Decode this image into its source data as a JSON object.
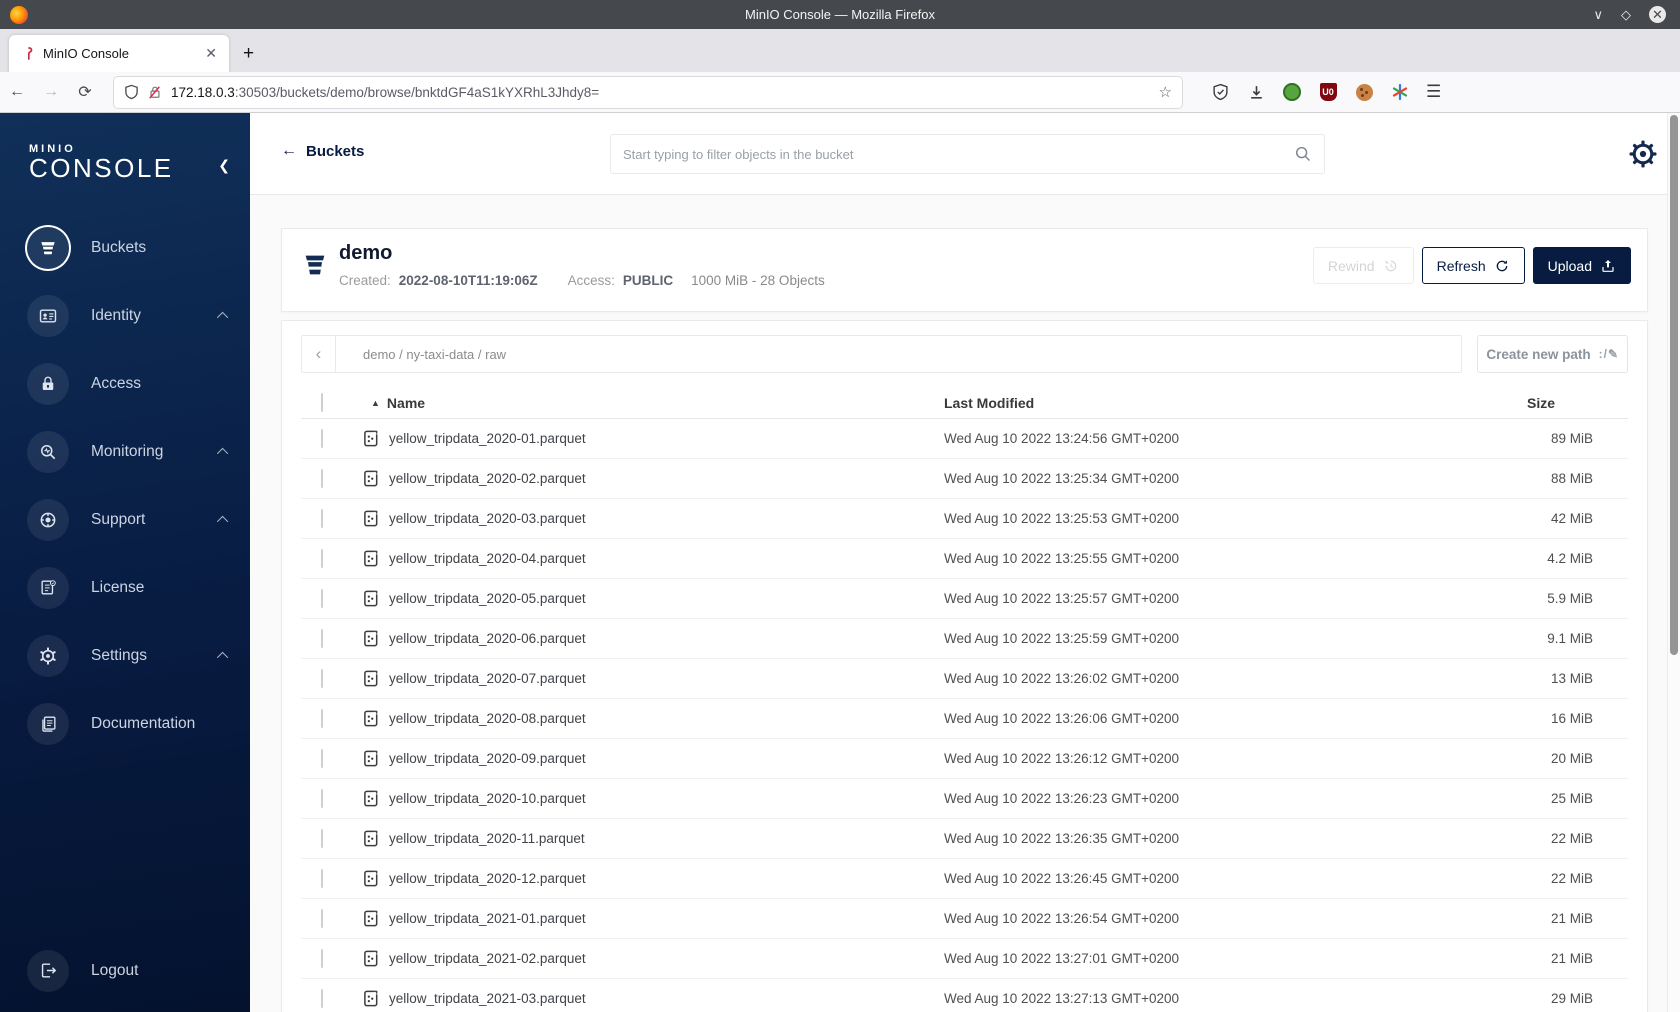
{
  "browser": {
    "window_title": "MinIO Console — Mozilla Firefox",
    "tab_title": "MinIO Console",
    "url_host": "172.18.0.3",
    "url_rest": ":30503/buckets/demo/browse/bnktdGF4aS1kYXRhL3Jhdy8="
  },
  "sidebar": {
    "logo_top": "MINIO",
    "logo_bottom": "CONSOLE",
    "items": [
      {
        "label": "Buckets",
        "selected": true
      },
      {
        "label": "Identity",
        "expandable": true
      },
      {
        "label": "Access"
      },
      {
        "label": "Monitoring",
        "expandable": true
      },
      {
        "label": "Support",
        "expandable": true
      },
      {
        "label": "License"
      },
      {
        "label": "Settings",
        "expandable": true
      },
      {
        "label": "Documentation"
      }
    ],
    "logout_label": "Logout"
  },
  "header": {
    "back_label": "Buckets",
    "search_placeholder": "Start typing to filter objects in the bucket"
  },
  "bucket": {
    "name": "demo",
    "created_label": "Created:",
    "created_value": "2022-08-10T11:19:06Z",
    "access_label": "Access:",
    "access_value": "PUBLIC",
    "usage": "1000 MiB - 28 Objects",
    "rewind_label": "Rewind",
    "refresh_label": "Refresh",
    "upload_label": "Upload"
  },
  "browse": {
    "path": "demo / ny-taxi-data / raw",
    "create_new_path_label": "Create new path"
  },
  "table": {
    "columns": {
      "name": "Name",
      "modified": "Last Modified",
      "size": "Size"
    },
    "rows": [
      {
        "name": "yellow_tripdata_2020-01.parquet",
        "modified": "Wed Aug 10 2022 13:24:56 GMT+0200",
        "size": "89 MiB"
      },
      {
        "name": "yellow_tripdata_2020-02.parquet",
        "modified": "Wed Aug 10 2022 13:25:34 GMT+0200",
        "size": "88 MiB"
      },
      {
        "name": "yellow_tripdata_2020-03.parquet",
        "modified": "Wed Aug 10 2022 13:25:53 GMT+0200",
        "size": "42 MiB"
      },
      {
        "name": "yellow_tripdata_2020-04.parquet",
        "modified": "Wed Aug 10 2022 13:25:55 GMT+0200",
        "size": "4.2 MiB"
      },
      {
        "name": "yellow_tripdata_2020-05.parquet",
        "modified": "Wed Aug 10 2022 13:25:57 GMT+0200",
        "size": "5.9 MiB"
      },
      {
        "name": "yellow_tripdata_2020-06.parquet",
        "modified": "Wed Aug 10 2022 13:25:59 GMT+0200",
        "size": "9.1 MiB"
      },
      {
        "name": "yellow_tripdata_2020-07.parquet",
        "modified": "Wed Aug 10 2022 13:26:02 GMT+0200",
        "size": "13 MiB"
      },
      {
        "name": "yellow_tripdata_2020-08.parquet",
        "modified": "Wed Aug 10 2022 13:26:06 GMT+0200",
        "size": "16 MiB"
      },
      {
        "name": "yellow_tripdata_2020-09.parquet",
        "modified": "Wed Aug 10 2022 13:26:12 GMT+0200",
        "size": "20 MiB"
      },
      {
        "name": "yellow_tripdata_2020-10.parquet",
        "modified": "Wed Aug 10 2022 13:26:23 GMT+0200",
        "size": "25 MiB"
      },
      {
        "name": "yellow_tripdata_2020-11.parquet",
        "modified": "Wed Aug 10 2022 13:26:35 GMT+0200",
        "size": "22 MiB"
      },
      {
        "name": "yellow_tripdata_2020-12.parquet",
        "modified": "Wed Aug 10 2022 13:26:45 GMT+0200",
        "size": "22 MiB"
      },
      {
        "name": "yellow_tripdata_2021-01.parquet",
        "modified": "Wed Aug 10 2022 13:26:54 GMT+0200",
        "size": "21 MiB"
      },
      {
        "name": "yellow_tripdata_2021-02.parquet",
        "modified": "Wed Aug 10 2022 13:27:01 GMT+0200",
        "size": "21 MiB"
      },
      {
        "name": "yellow_tripdata_2021-03.parquet",
        "modified": "Wed Aug 10 2022 13:27:13 GMT+0200",
        "size": "29 MiB"
      }
    ]
  },
  "colors": {
    "navy": "#081c42",
    "header_bg": "#45494e",
    "accent_red": "#c72c48"
  }
}
